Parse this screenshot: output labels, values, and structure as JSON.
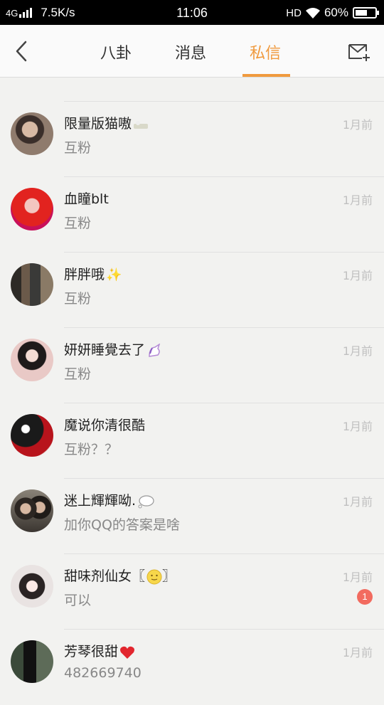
{
  "status_bar": {
    "network": "4G",
    "speed": "7.5K/s",
    "time": "11:06",
    "hd": "HD",
    "battery_pct": "60%",
    "battery_level": 0.6
  },
  "nav": {
    "tabs": [
      "八卦",
      "消息",
      "私信"
    ],
    "active_tab": 2
  },
  "conversations": [
    {
      "name": "限量版猫嗷",
      "name_emoji": "cat-emoji",
      "preview": "互粉",
      "time": "1月前",
      "unread": ""
    },
    {
      "name": "血瞳blt",
      "name_emoji": "",
      "preview": "互粉",
      "time": "1月前",
      "unread": ""
    },
    {
      "name": "胖胖哦",
      "name_emoji": "sparkles-emoji",
      "preview": "互粉",
      "time": "1月前",
      "unread": ""
    },
    {
      "name": "妍妍睡覺去了",
      "name_emoji": "unicorn-emoji",
      "preview": "互粉",
      "time": "1月前",
      "unread": ""
    },
    {
      "name": "魔说你清很酷",
      "name_emoji": "",
      "preview": "互粉？？",
      "time": "1月前",
      "unread": ""
    },
    {
      "name": "迷上輝輝呦.",
      "name_emoji": "thought-bubble-emoji",
      "preview": "加你QQ的答案是啥",
      "time": "1月前",
      "unread": ""
    },
    {
      "name": "甜味剂仙女〖",
      "name_emoji": "smiley-emoji",
      "name_suffix": "〗",
      "preview": "可以",
      "time": "1月前",
      "unread": "1"
    },
    {
      "name": "芳琴很甜",
      "name_emoji": "heart-emoji",
      "preview": "482669740",
      "time": "1月前",
      "unread": ""
    }
  ]
}
